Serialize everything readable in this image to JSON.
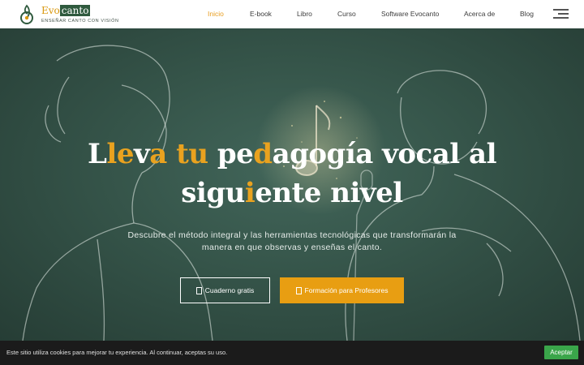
{
  "brand": {
    "name_part1": "Evo",
    "name_part2": "canto",
    "tagline": "ENSEÑAR CANTO CON VISIÓN"
  },
  "nav": {
    "items": [
      {
        "label": "Inicio",
        "active": true
      },
      {
        "label": "E-book",
        "active": false
      },
      {
        "label": "Libro",
        "active": false
      },
      {
        "label": "Curso",
        "active": false
      },
      {
        "label": "Software Evocanto",
        "active": false
      },
      {
        "label": "Acerca de",
        "active": false
      },
      {
        "label": "Blog",
        "active": false
      }
    ],
    "menu_icon": "hamburger-menu-icon"
  },
  "hero": {
    "title_segments": [
      {
        "text": "L",
        "highlight": false
      },
      {
        "text": "le",
        "highlight": true
      },
      {
        "text": "v",
        "highlight": false
      },
      {
        "text": "a",
        "highlight": true
      },
      {
        "text": " ",
        "highlight": false
      },
      {
        "text": "tu",
        "highlight": true
      },
      {
        "text": " pe",
        "highlight": false
      },
      {
        "text": "d",
        "highlight": true
      },
      {
        "text": "agogía vocal al",
        "highlight": false
      },
      {
        "text": "\n",
        "highlight": false
      },
      {
        "text": "sigu",
        "highlight": false
      },
      {
        "text": "i",
        "highlight": true
      },
      {
        "text": "ente nivel",
        "highlight": false
      }
    ],
    "subtitle": "Descubre el método integral y las herramientas tecnológicas que transformarán la manera en que observas y enseñas el canto.",
    "button_primary_label": "Cuaderno gratis",
    "button_secondary_label": "Formación para Profesores"
  },
  "cookie": {
    "message": "Este sitio utiliza cookies para mejorar tu experiencia. Al continuar, aceptas su uso.",
    "accept_label": "Aceptar"
  },
  "colors": {
    "accent": "#e89e12",
    "hero_bg": "#355449",
    "cookie_accept": "#3aa54a",
    "nav_active": "#e89e21"
  }
}
